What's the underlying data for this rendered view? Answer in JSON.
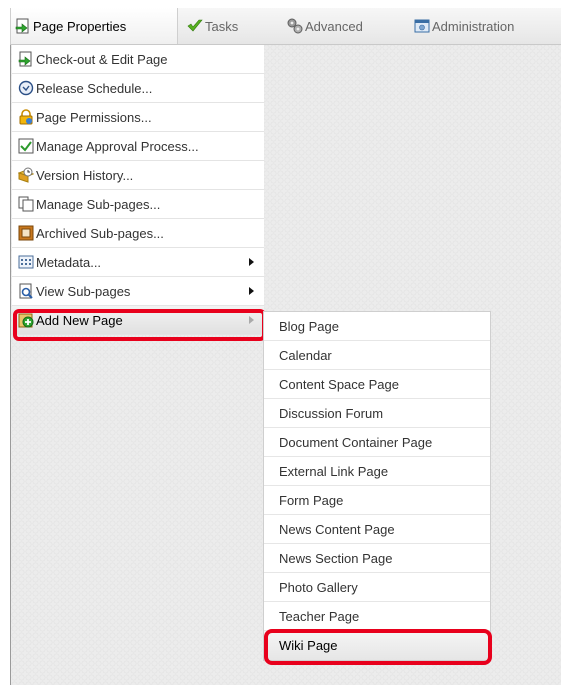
{
  "menubar": {
    "tabs": [
      {
        "label": "Page Properties",
        "icon": "page-properties-icon"
      },
      {
        "label": "Tasks",
        "icon": "checkmark-icon"
      },
      {
        "label": "Advanced",
        "icon": "gears-icon"
      },
      {
        "label": "Administration",
        "icon": "admin-window-icon"
      }
    ]
  },
  "main_menu": {
    "items": [
      {
        "label": "Check-out & Edit Page",
        "icon": "checkout-edit-icon"
      },
      {
        "label": "Release Schedule...",
        "icon": "clock-icon"
      },
      {
        "label": "Page Permissions...",
        "icon": "lock-icon"
      },
      {
        "label": "Manage Approval Process...",
        "icon": "approval-check-icon"
      },
      {
        "label": "Version History...",
        "icon": "version-history-icon"
      },
      {
        "label": "Manage Sub-pages...",
        "icon": "sub-pages-icon"
      },
      {
        "label": "Archived Sub-pages...",
        "icon": "archive-icon"
      },
      {
        "label": "Metadata...",
        "icon": "metadata-grid-icon"
      },
      {
        "label": "View Sub-pages",
        "icon": "view-subpages-icon"
      },
      {
        "label": "Add New Page",
        "icon": "add-page-icon"
      }
    ]
  },
  "submenu": {
    "items": [
      "Blog Page",
      "Calendar",
      "Content Space Page",
      "Discussion Forum",
      "Document Container Page",
      "External Link Page",
      "Form Page",
      "News Content Page",
      "News Section Page",
      "Photo Gallery",
      "Teacher Page",
      "Wiki Page"
    ]
  },
  "colors": {
    "highlight": "#e8001c",
    "menu_bg": "#ffffff",
    "pattern_bg": "#ececec"
  }
}
